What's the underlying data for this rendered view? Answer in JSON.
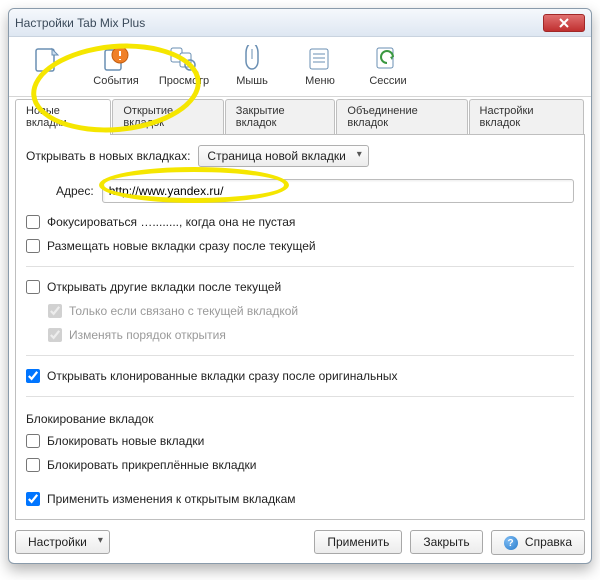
{
  "window": {
    "title": "Настройки Tab Mix Plus"
  },
  "toolbar": {
    "items": [
      {
        "label": ""
      },
      {
        "label": "События"
      },
      {
        "label": "Просмотр"
      },
      {
        "label": "Мышь"
      },
      {
        "label": "Меню"
      },
      {
        "label": "Сессии"
      }
    ]
  },
  "tabs": [
    {
      "label": "Новые вкладки"
    },
    {
      "label": "Открытие вкладок"
    },
    {
      "label": "Закрытие вкладок"
    },
    {
      "label": "Объединение вкладок"
    },
    {
      "label": "Настройки вкладок"
    }
  ],
  "open_in_new_tabs_label": "Открывать в новых вкладках:",
  "open_target": "Страница новой вкладки",
  "address": {
    "label": "Адрес:",
    "value": "http://www.yandex.ru/"
  },
  "focus_on_nonempty": "Фокусироваться …........, когда она не пустая",
  "place_after_current": "Размещать новые вкладки сразу после текущей",
  "open_other_after_current": "Открывать другие вкладки после текущей",
  "only_if_related": "Только если связано с текущей вкладкой",
  "change_open_order": "Изменять порядок открытия",
  "open_cloned_after_orig": "Открывать клонированные вкладки сразу после оригинальных",
  "lock_section_title": "Блокирование вкладок",
  "lock_new": "Блокировать новые вкладки",
  "lock_pinned": "Блокировать прикреплённые вкладки",
  "apply_to_open": "Применить изменения к открытым вкладкам",
  "footer": {
    "settings": "Настройки",
    "apply": "Применить",
    "close": "Закрыть",
    "help": "Справка"
  }
}
